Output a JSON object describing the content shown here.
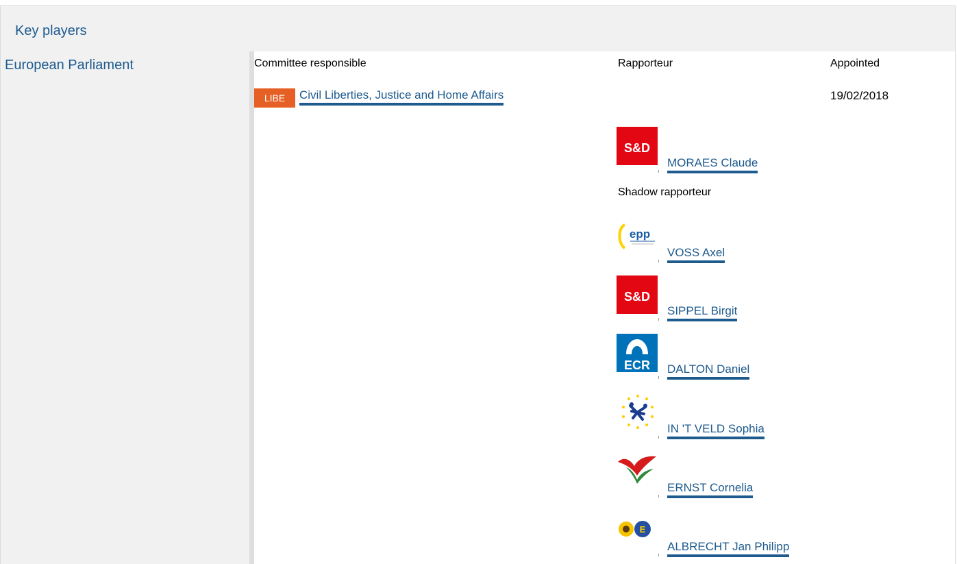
{
  "header": {
    "title": "Key players"
  },
  "institution": {
    "name": "European Parliament"
  },
  "columns": {
    "committee": "Committee responsible",
    "rapporteur": "Rapporteur",
    "appointed": "Appointed"
  },
  "committee": {
    "badge": "LIBE",
    "name": "Civil Liberties, Justice and Home Affairs",
    "appointed_date": "19/02/2018"
  },
  "rapporteur": {
    "group_icon": "sd-logo",
    "name": "MORAES Claude"
  },
  "shadow": {
    "label": "Shadow rapporteur",
    "members": [
      {
        "group_icon": "epp-logo",
        "name": "VOSS Axel"
      },
      {
        "group_icon": "sd-logo",
        "name": "SIPPEL Birgit"
      },
      {
        "group_icon": "ecr-logo",
        "name": "DALTON Daniel"
      },
      {
        "group_icon": "alde-logo",
        "name": "IN 'T VELD Sophia"
      },
      {
        "group_icon": "gue-ngl-logo",
        "name": "ERNST Cornelia"
      },
      {
        "group_icon": "greens-efa-logo",
        "name": "ALBRECHT Jan Philipp"
      }
    ]
  },
  "colors": {
    "link": "#1d5a8e",
    "badge": "#e65f25",
    "sd_red": "#e30613",
    "ecr_blue": "#0072b9"
  }
}
